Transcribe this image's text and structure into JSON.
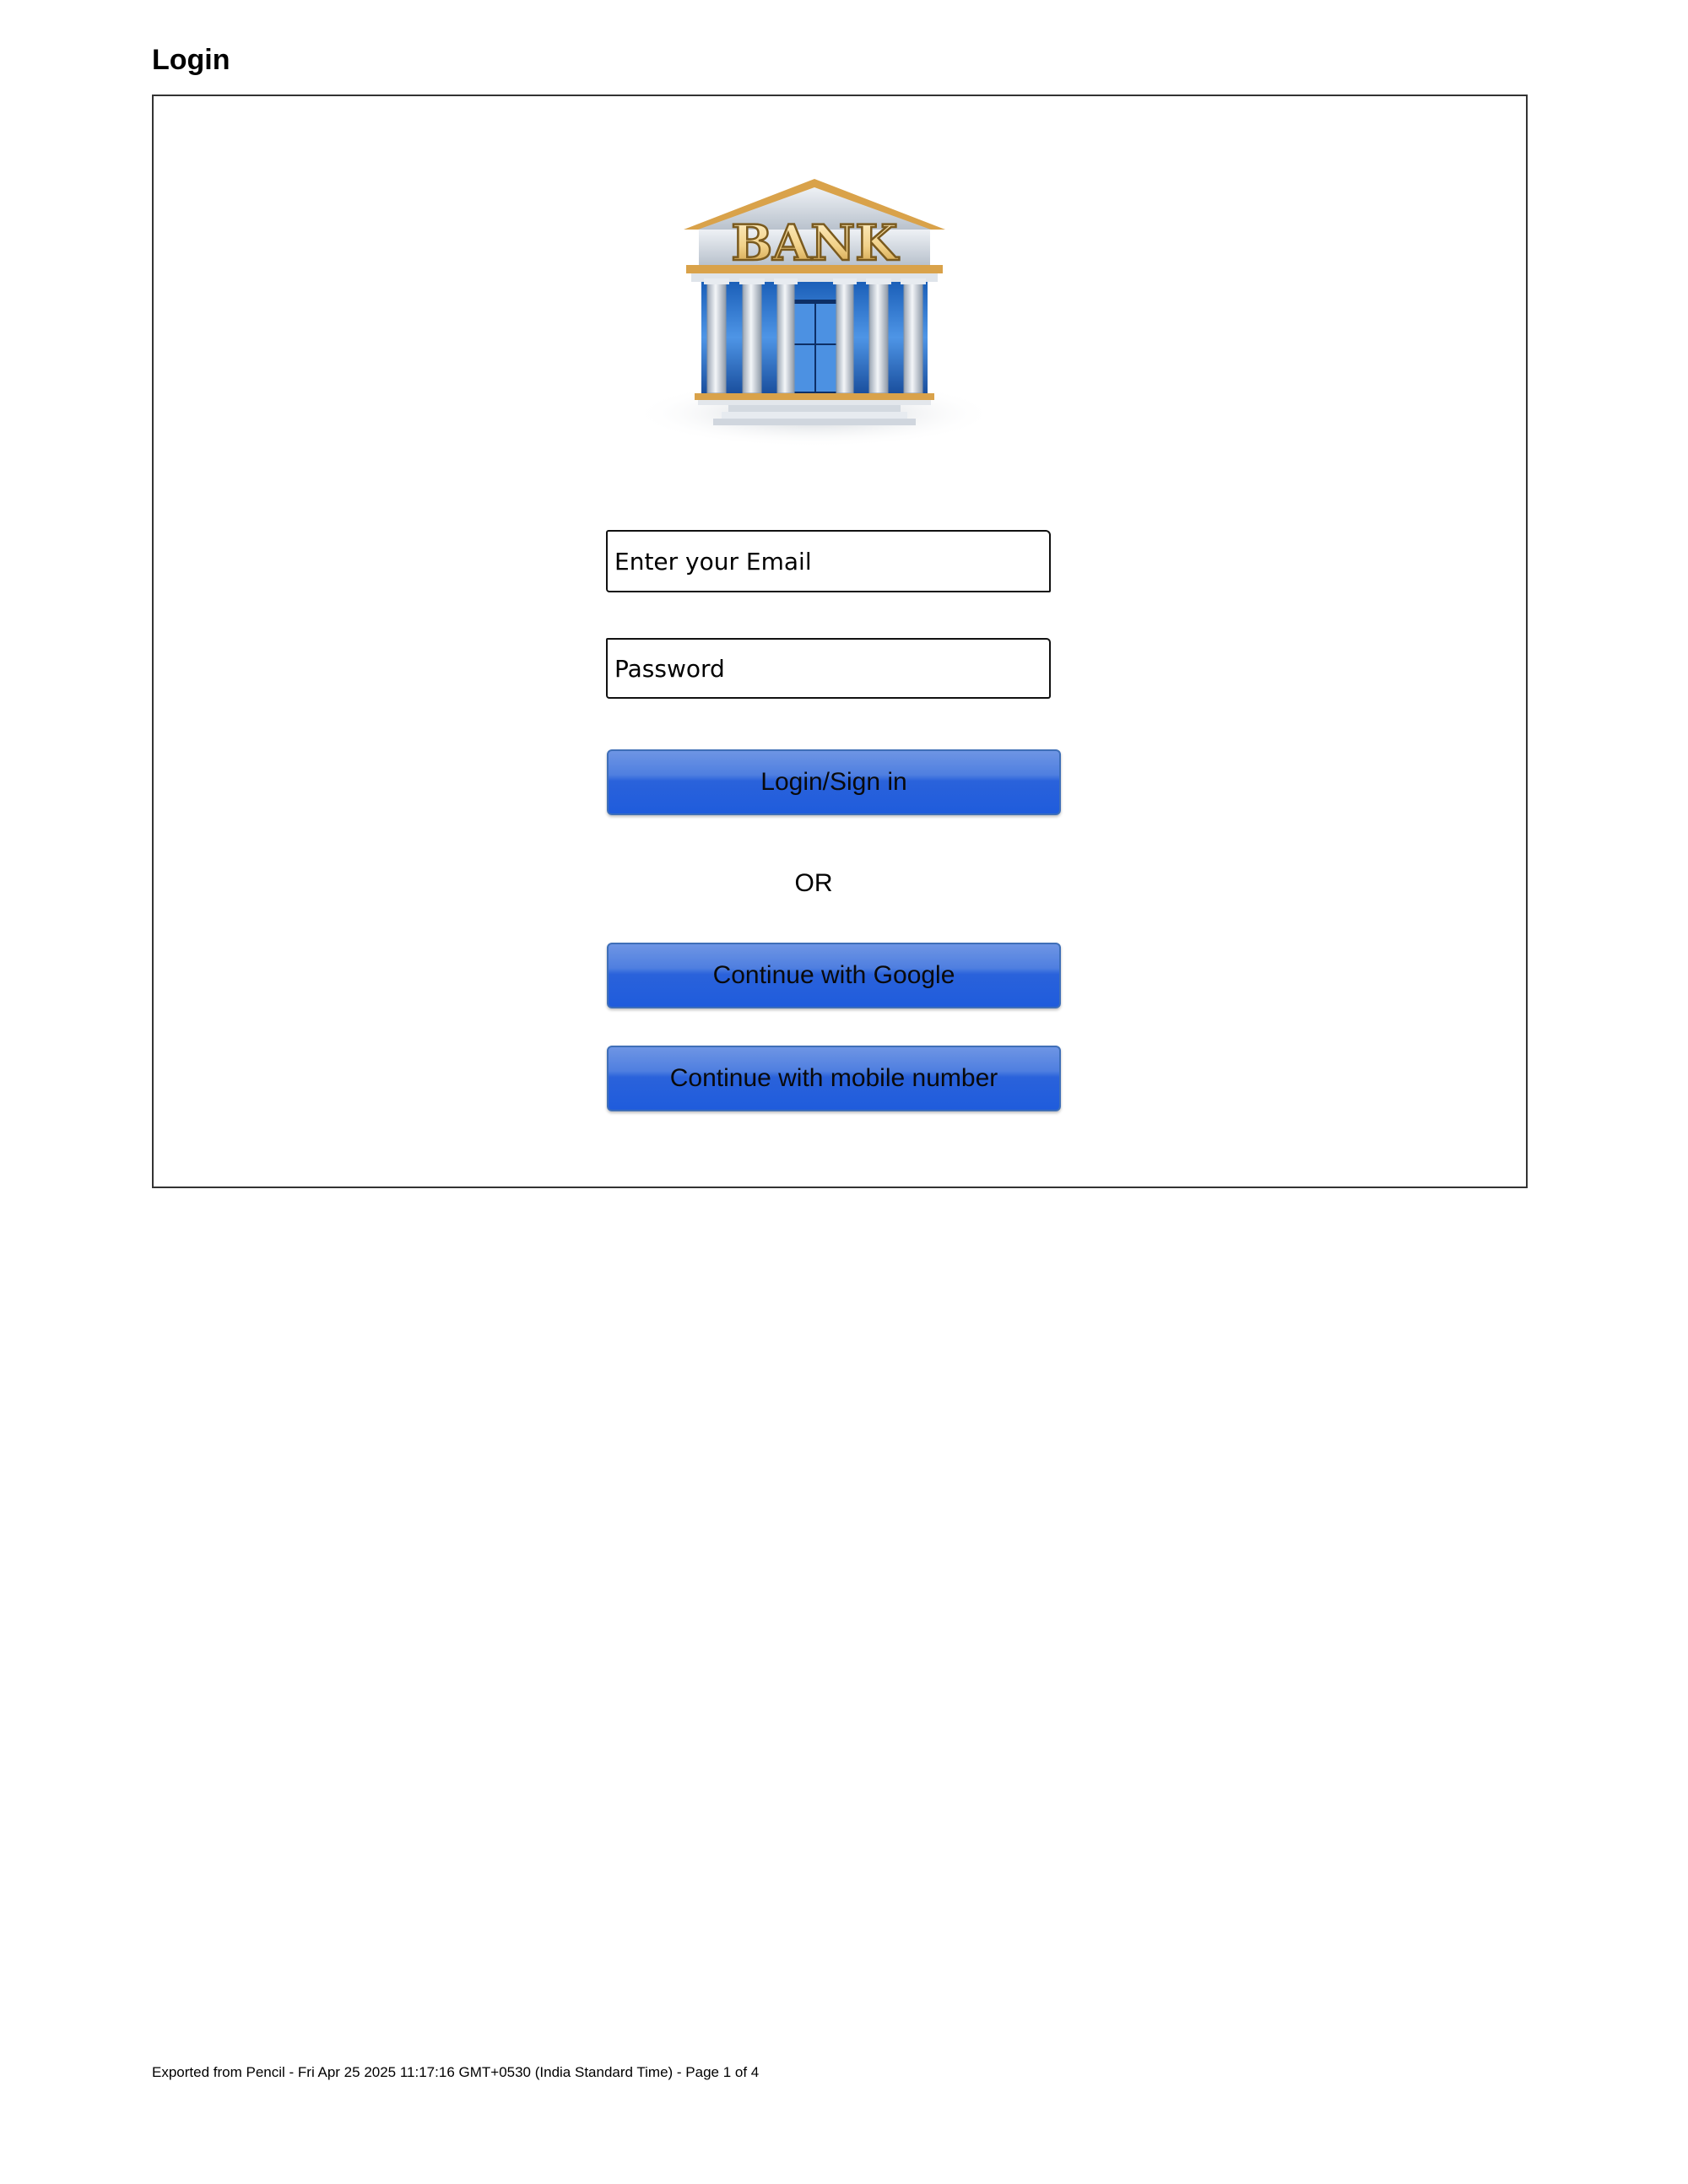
{
  "page": {
    "title": "Login"
  },
  "logo": {
    "text": "BANK",
    "icon": "bank-building-icon"
  },
  "form": {
    "email_placeholder": "Enter your Email",
    "password_placeholder": "Password",
    "login_button_label": "Login/Sign in",
    "or_label": "OR",
    "google_button_label": "Continue with Google",
    "mobile_button_label": "Continue with mobile number"
  },
  "footer": {
    "text": "Exported from Pencil - Fri Apr 25 2025 11:17:16 GMT+0530 (India Standard Time) - Page 1 of 4"
  },
  "colors": {
    "button_blue": "#1f5cdc",
    "logo_gold": "#d9a24a",
    "frame_border": "#333333"
  }
}
